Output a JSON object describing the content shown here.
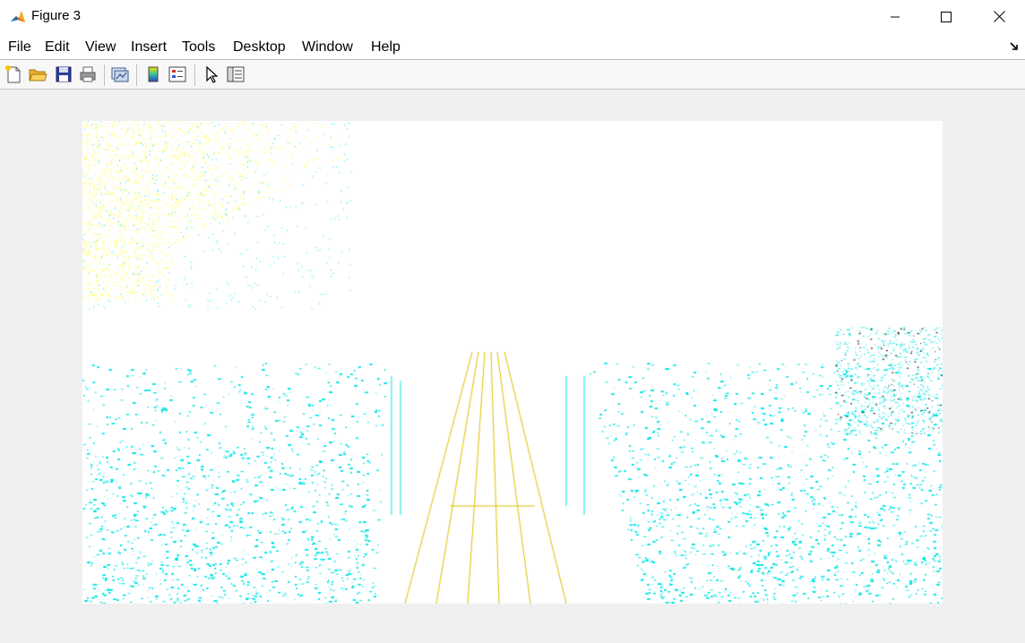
{
  "window": {
    "title": "Figure 3",
    "icon": "matlab-icon",
    "controls": [
      "minimize-icon",
      "maximize-icon",
      "close-icon"
    ]
  },
  "menubar": {
    "items": [
      "File",
      "Edit",
      "View",
      "Insert",
      "Tools",
      "Desktop",
      "Window",
      "Help"
    ],
    "dock_icon": "dock-arrow-icon"
  },
  "toolbar": {
    "buttons": [
      {
        "name": "new-figure-button",
        "icon": "new-file-icon"
      },
      {
        "name": "open-file-button",
        "icon": "folder-open-icon"
      },
      {
        "name": "save-figure-button",
        "icon": "save-icon"
      },
      {
        "name": "print-figure-button",
        "icon": "printer-icon"
      },
      {
        "name": "link-plot-button",
        "icon": "link-plot-icon"
      },
      {
        "name": "insert-colorbar-button",
        "icon": "colorbar-icon"
      },
      {
        "name": "insert-legend-button",
        "icon": "legend-icon"
      },
      {
        "name": "edit-plot-button",
        "icon": "pointer-icon"
      },
      {
        "name": "plot-tools-button",
        "icon": "plot-tools-icon"
      }
    ]
  },
  "figure": {
    "image_description_colors": {
      "background": "#ffffff",
      "water": "#00e5e5",
      "sky_edges": "#ffff00",
      "dock_edges": "#e0c000",
      "dark_specks": "#000000"
    }
  }
}
